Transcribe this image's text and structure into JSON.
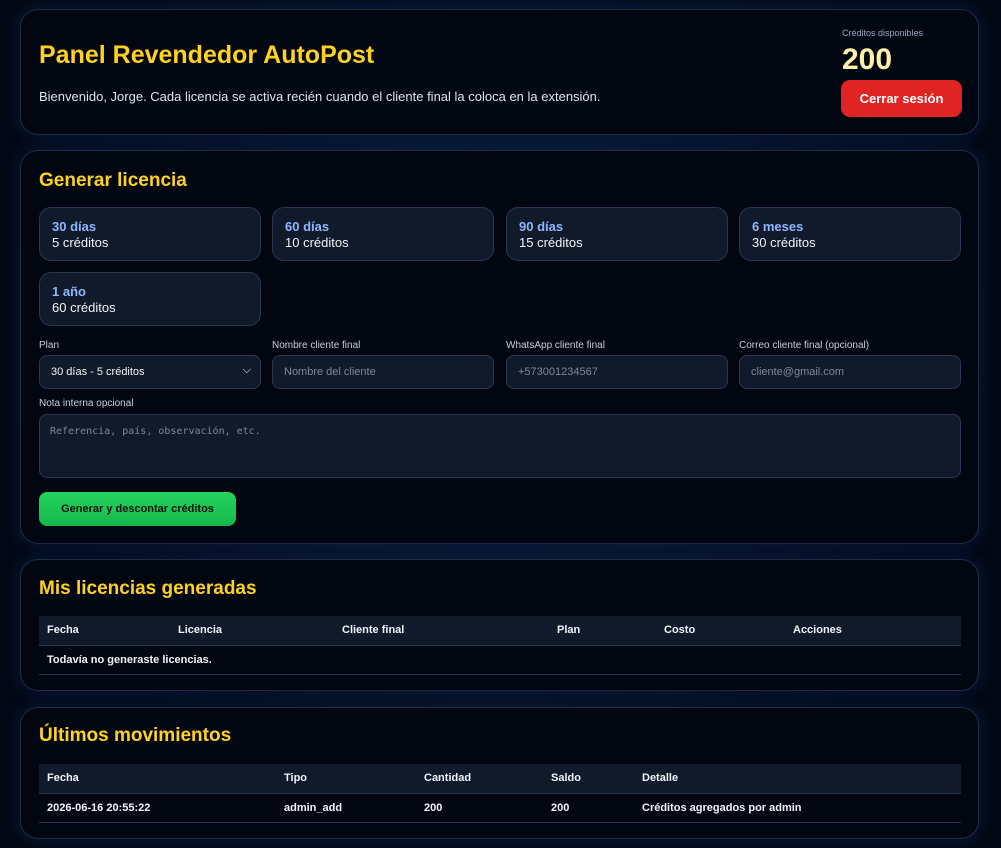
{
  "header": {
    "title": "Panel Revendedor AutoPost",
    "welcome": "Bienvenido, Jorge. Cada licencia se activa recién cuando el cliente final la coloca en la extensión.",
    "credits_label": "Créditos disponibles",
    "credits_value": "200",
    "logout_label": "Cerrar sesión"
  },
  "generate": {
    "title": "Generar licencia",
    "plans": [
      {
        "name": "30 días",
        "cost": "5 créditos"
      },
      {
        "name": "60 días",
        "cost": "10 créditos"
      },
      {
        "name": "90 días",
        "cost": "15 créditos"
      },
      {
        "name": "6 meses",
        "cost": "30 créditos"
      },
      {
        "name": "1 año",
        "cost": "60 créditos"
      }
    ],
    "plan_label": "Plan",
    "plan_selected": "30 días - 5 créditos",
    "client_name_label": "Nombre cliente final",
    "client_name_placeholder": "Nombre del cliente",
    "whatsapp_label": "WhatsApp cliente final",
    "whatsapp_placeholder": "+573001234567",
    "email_label": "Correo cliente final (opcional)",
    "email_placeholder": "cliente@gmail.com",
    "note_label": "Nota interna opcional",
    "note_placeholder": "Referencia, país, observación, etc.",
    "submit_label": "Generar y descontar créditos"
  },
  "licenses": {
    "title": "Mis licencias generadas",
    "columns": [
      "Fecha",
      "Licencia",
      "Cliente final",
      "Plan",
      "Costo",
      "Acciones"
    ],
    "empty_message": "Todavía no generaste licencias."
  },
  "movements": {
    "title": "Últimos movimientos",
    "columns": [
      "Fecha",
      "Tipo",
      "Cantidad",
      "Saldo",
      "Detalle"
    ],
    "rows": [
      {
        "fecha": "2026-06-16 20:55:22",
        "tipo": "admin_add",
        "cantidad": "200",
        "saldo": "200",
        "detalle": "Créditos agregados por admin"
      }
    ]
  },
  "colors": {
    "accent": "#ffd21f",
    "plan_name": "#8fb7ff",
    "danger": "#e02424",
    "success": "#24d35f"
  }
}
